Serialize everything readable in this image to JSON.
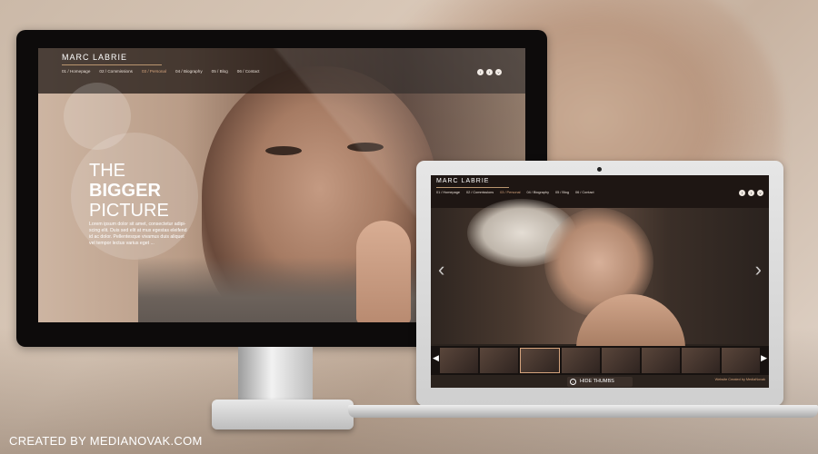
{
  "monitor": {
    "brand": "MARC LABRIE",
    "menu": [
      "01 / Homepage",
      "02 / Commissions",
      "03 / Personal",
      "04 / Biography",
      "05 / Blog",
      "06 / Contact"
    ],
    "active_menu": "03 / Personal",
    "headline_line1": "THE",
    "headline_line2": "BIGGER",
    "headline_line3": "PICTURE",
    "body_text": "Lorem ipsum dolor sit amet, consectetur adipi- scing elit. Duis sed elit at mux egestas eleifend id ac dolor. Pellentesque vivamus duis aliquet vel tempor lectus varius eget ...",
    "socials": [
      "f",
      "t",
      "v"
    ]
  },
  "laptop": {
    "brand": "MARC LABRIE",
    "menu": [
      "01 / Homepage",
      "02 / Commissions",
      "03 / Personal",
      "04 / Biography",
      "05 / Blog",
      "06 / Contact"
    ],
    "active_menu": "03 / Personal",
    "socials": [
      "f",
      "t",
      "v"
    ],
    "prev_arrow": "‹",
    "next_arrow": "›",
    "thumb_count": 8,
    "hide_button": "HIDE THUMBS",
    "credit": "Website Created by MediaNovak"
  },
  "footer": {
    "credit": "CREATED BY MEDIANOVAK.COM"
  }
}
